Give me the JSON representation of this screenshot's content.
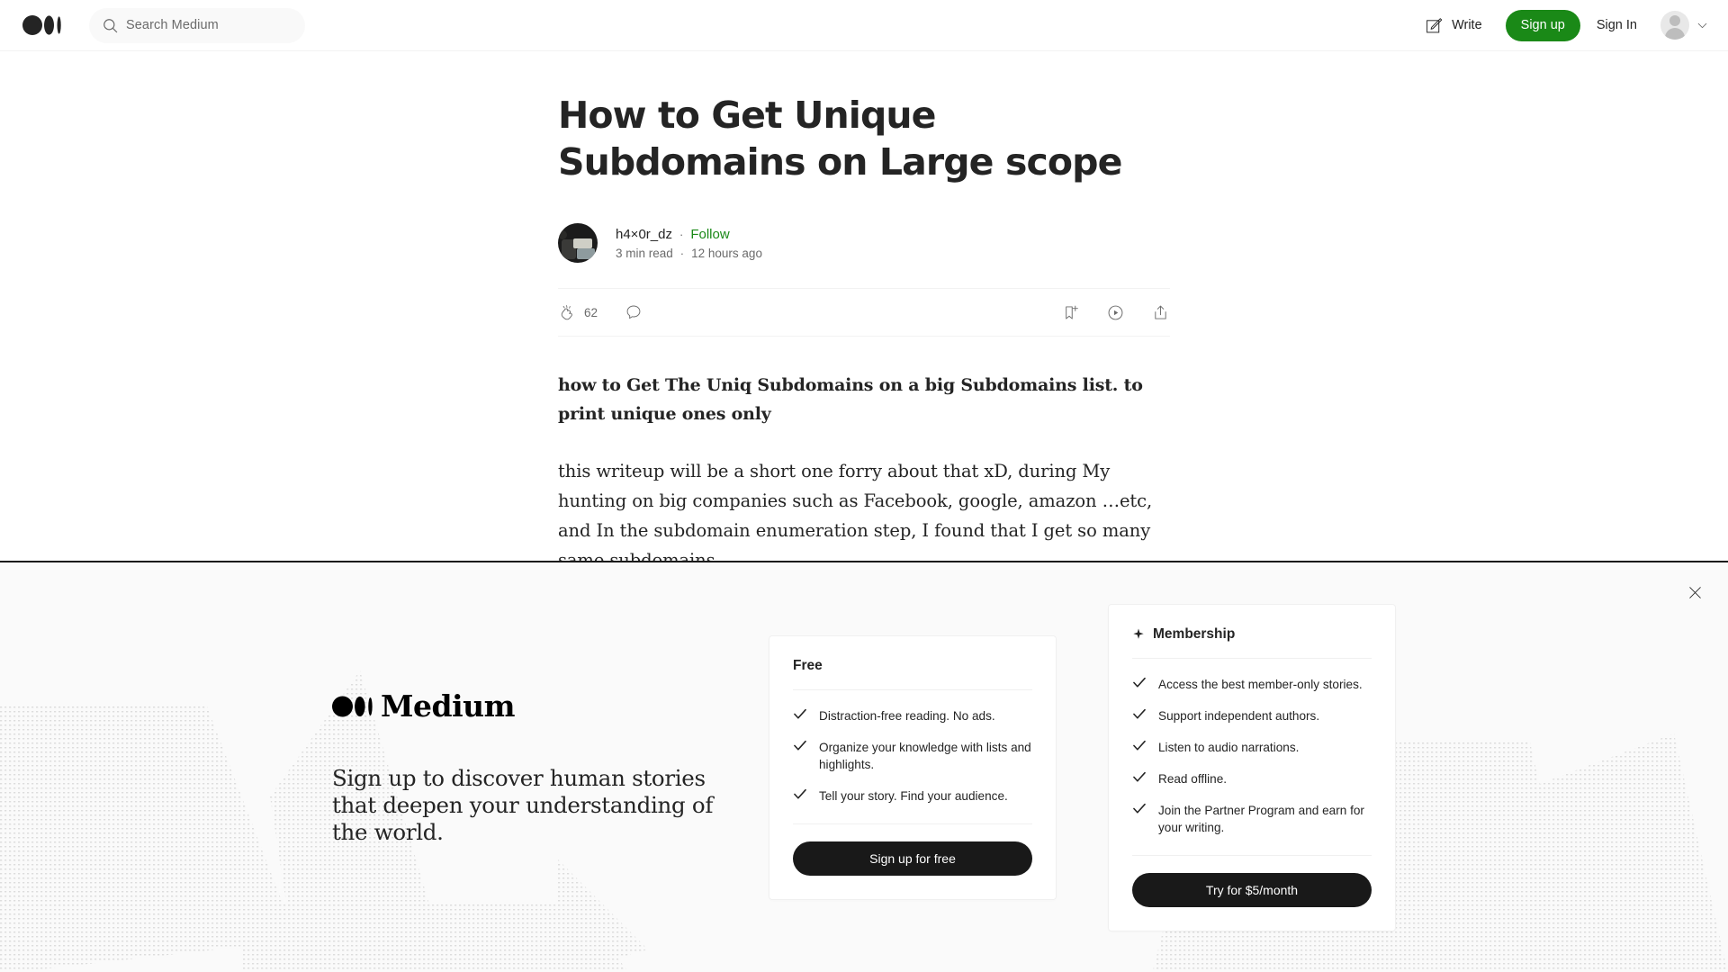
{
  "header": {
    "logo_icon": "medium-logo-icon",
    "search": {
      "icon": "search-icon",
      "placeholder": "Search Medium",
      "value": ""
    },
    "write_label": "Write",
    "write_icon": "write-pencil-icon",
    "signup_label": "Sign up",
    "signin_label": "Sign In",
    "avatar_icon": "user-avatar-icon",
    "chevron_icon": "chevron-down-icon",
    "signup_color": "#1a8917"
  },
  "article": {
    "title": "How to Get Unique Subdomains on Large scope",
    "author": {
      "name": "h4×0r_dz",
      "follow_label": "Follow",
      "separator": "·",
      "read_time": "3 min read",
      "published": "12 hours ago",
      "avatar_icon": "author-avatar-photo"
    },
    "engagement": {
      "clap_icon": "clap-icon",
      "clap_count": "62",
      "comment_icon": "comment-icon",
      "bookmark_icon": "bookmark-add-icon",
      "listen_icon": "play-audio-icon",
      "share_icon": "share-icon"
    },
    "lead": "how to Get The Uniq Subdomains on a big Subdomains list. to print unique ones only",
    "paragraph": "this writeup will be a short one forry about that xD, during My hunting on big companies such as Facebook, google, amazon …etc, and In the subdomain enumeration step, I found that I get so many same subdomains."
  },
  "overlay": {
    "close_icon": "close-icon",
    "brand_icon": "medium-logo-icon",
    "brand_name": "Medium",
    "tagline": "Sign up to discover human stories that deepen your understanding of the world.",
    "free_card": {
      "title": "Free",
      "features": [
        "Distraction-free reading. No ads.",
        "Organize your knowledge with lists and highlights.",
        "Tell your story. Find your audience."
      ],
      "cta_label": "Sign up for free",
      "check_icon": "check-icon"
    },
    "membership_card": {
      "sparkle_icon": "sparkle-icon",
      "title": "Membership",
      "features": [
        "Access the best member-only stories.",
        "Support independent authors.",
        "Listen to audio narrations.",
        "Read offline.",
        "Join the Partner Program and earn for your writing."
      ],
      "cta_label": "Try for $5/month",
      "check_icon": "check-icon"
    }
  }
}
